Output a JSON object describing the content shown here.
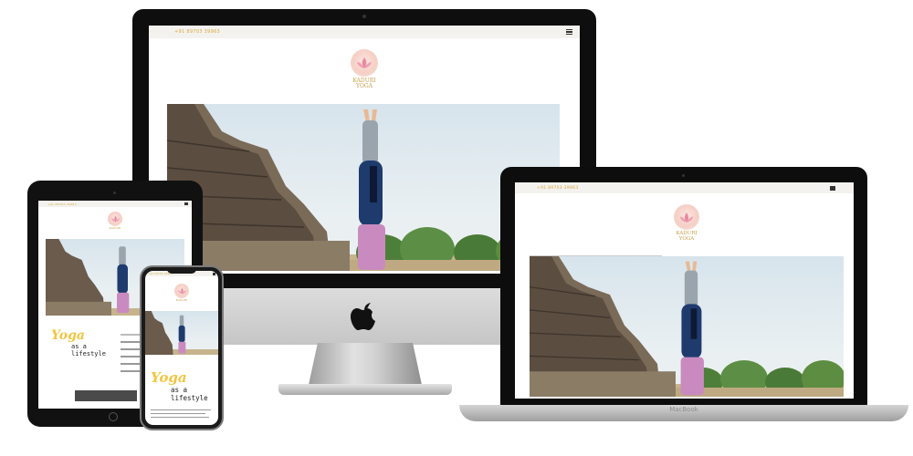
{
  "site": {
    "phone_number": "+91 89703 39963",
    "logo_top": "KADURI",
    "logo_bottom": "YOGA",
    "tagline_word": "Yoga",
    "tagline_rest_1": "as a",
    "tagline_rest_2": "lifestyle"
  },
  "devices": {
    "laptop_brand": "MacBook"
  },
  "icons": {
    "menu": "hamburger-menu-icon",
    "apple": "apple-logo-icon",
    "lotus": "lotus-logo-icon"
  },
  "colors": {
    "accent_gold": "#d9a93b",
    "yoga_yellow": "#f2c542",
    "logo_pink": "#e88aa0",
    "device_black": "#0e0e0e"
  }
}
